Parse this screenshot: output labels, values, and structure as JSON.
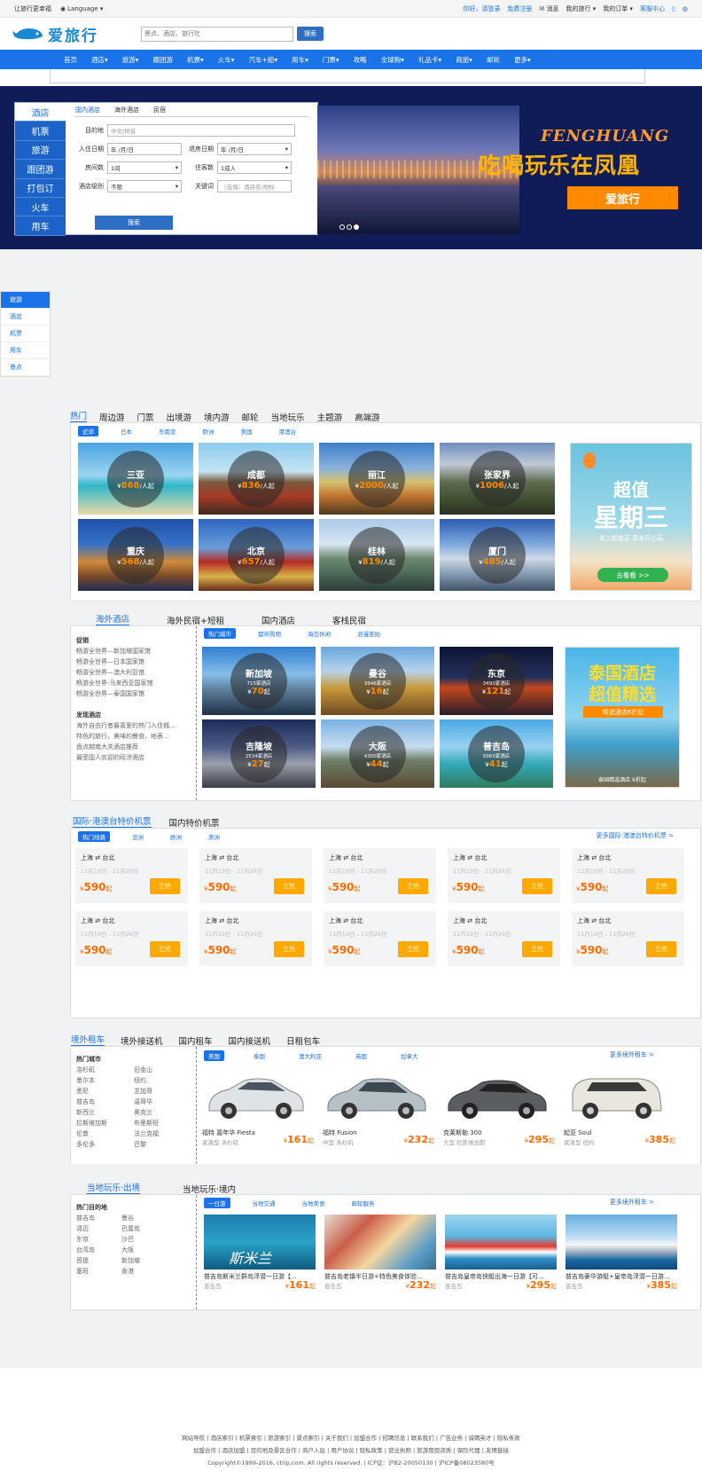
{
  "topbar": {
    "left": "让旅行更幸福",
    "language": "Language ▾",
    "right": [
      "你好，请登录",
      "免费注册",
      "消息",
      "我的旅行 ▾",
      "我的订单 ▾",
      "客服中心"
    ]
  },
  "header": {
    "logo_text": "爱旅行",
    "search_placeholder": "景点、酒店、旅行社",
    "search_button": "搜索"
  },
  "nav": [
    "首页",
    "酒店▾",
    "旅游▾",
    "跟团游",
    "机票▾",
    "火车▾",
    "汽车+船▾",
    "用车▾",
    "门票▾",
    "攻略",
    "全球购▾",
    "礼品卡▾",
    "商旅▾",
    "邮轮",
    "更多▾"
  ],
  "banner": {
    "side_tabs": [
      "酒店",
      "机票",
      "旅游",
      "跟团游",
      "打包订",
      "火车",
      "用车"
    ],
    "sub_tabs": [
      "国内酒店",
      "海外酒店",
      "民宿"
    ],
    "form": {
      "dest_label": "目的地",
      "dest_ph": "中文/拼音",
      "checkin_label": "入住日期",
      "checkin_ph": "年 /月/日",
      "checkout_label": "退房日期",
      "checkout_ph": "年 /月/日",
      "rooms_label": "房间数",
      "rooms_val": "1间",
      "guests_label": "住客数",
      "guests_val": "1成人",
      "level_label": "酒店级别",
      "level_val": "不限",
      "kw_label": "关键词",
      "kw_ph": "（选填）酒店名/地标",
      "submit": "搜索"
    },
    "title_en": "FENGHUANG",
    "slogan": "吃喝玩乐在凤凰",
    "brand_button": "爱旅行"
  },
  "side_nav": [
    "旅游",
    "酒店",
    "机票",
    "用车",
    "景点"
  ],
  "travel": {
    "tabs": [
      "热门",
      "周边游",
      "门票",
      "出境游",
      "境内游",
      "邮轮",
      "当地玩乐",
      "主题游",
      "高端游"
    ],
    "pills": [
      "近郊",
      "日本",
      "东南亚",
      "欧洲",
      "美国",
      "港澳台"
    ],
    "cards": [
      {
        "name": "三亚",
        "price": "868",
        "unit": "/人起"
      },
      {
        "name": "成都",
        "price": "836",
        "unit": "/人起"
      },
      {
        "name": "丽江",
        "price": "2000",
        "unit": "/人起"
      },
      {
        "name": "张家界",
        "price": "1006",
        "unit": "/人起"
      },
      {
        "name": "重庆",
        "price": "568",
        "unit": "/人起"
      },
      {
        "name": "北京",
        "price": "657",
        "unit": "/人起"
      },
      {
        "name": "桂林",
        "price": "819",
        "unit": "/人起"
      },
      {
        "name": "厦门",
        "price": "485",
        "unit": "/人起"
      }
    ],
    "promo": {
      "title": "超值",
      "title2": "星期三",
      "sub": "周三超值买 周末开心玩",
      "btn": "去看看 >>"
    }
  },
  "hotel": {
    "tabs": [
      "海外酒店",
      "海外民宿+短租",
      "国内酒店",
      "客栈民宿"
    ],
    "left_h1": "促销",
    "left_list1": [
      "畅游全世界—新加坡国家馆",
      "畅游全世界—日本国家馆",
      "畅游全世界—澳大利亚馆",
      "畅游全世界-马来西亚国家馆",
      "畅游全世界—泰国国家馆"
    ],
    "left_h2": "发现酒店",
    "left_list2": [
      "海外自由行者最喜爱的热门入住城...",
      "特色的旅行，美味的餐食，地表...",
      "盘点越南大关酒店推荐",
      "最受国人欢迎的经济酒店"
    ],
    "pills": [
      "热门城市",
      "都市购物",
      "海岛休闲",
      "浪漫旅拍"
    ],
    "cards": [
      {
        "name": "新加坡",
        "sub": "715家酒店",
        "price": "70",
        "unit": "起"
      },
      {
        "name": "曼谷",
        "sub": "3946家酒店",
        "price": "16",
        "unit": "起"
      },
      {
        "name": "东京",
        "sub": "3493家酒店",
        "price": "121",
        "unit": "起"
      },
      {
        "name": "吉隆坡",
        "sub": "2534家酒店",
        "price": "27",
        "unit": "起"
      },
      {
        "name": "大阪",
        "sub": "4300家酒店",
        "price": "44",
        "unit": "起"
      },
      {
        "name": "普吉岛",
        "sub": "5063家酒店",
        "price": "41",
        "unit": "起"
      }
    ],
    "promo": {
      "title": "泰国酒店",
      "title2": "超值精选",
      "tag": "精选酒店6折起",
      "caption": "泰国精选酒店 6折起"
    }
  },
  "flights": {
    "tabs": [
      "国际·港澳台特价机票",
      "国内特价机票"
    ],
    "pills": [
      "热门线路",
      "亚洲",
      "欧洲",
      "美洲"
    ],
    "more": "更多国际·港澳台特价机票 >",
    "items": [
      {
        "from": "上海",
        "to": "台北",
        "dates": "11月19日 - 11月26日",
        "price": "590",
        "btn": "立抢"
      },
      {
        "from": "上海",
        "to": "台北",
        "dates": "11月19日 - 11月26日",
        "price": "590",
        "btn": "立抢"
      },
      {
        "from": "上海",
        "to": "台北",
        "dates": "11月19日 - 11月26日",
        "price": "590",
        "btn": "立抢"
      },
      {
        "from": "上海",
        "to": "台北",
        "dates": "11月19日 - 11月26日",
        "price": "590",
        "btn": "立抢"
      },
      {
        "from": "上海",
        "to": "台北",
        "dates": "11月19日 - 11月26日",
        "price": "590",
        "btn": "立抢"
      },
      {
        "from": "上海",
        "to": "台北",
        "dates": "11月19日 - 11月26日",
        "price": "590",
        "btn": "立抢"
      },
      {
        "from": "上海",
        "to": "台北",
        "dates": "11月19日 - 11月26日",
        "price": "590",
        "btn": "立抢"
      },
      {
        "from": "上海",
        "to": "台北",
        "dates": "11月19日 - 11月26日",
        "price": "590",
        "btn": "立抢"
      },
      {
        "from": "上海",
        "to": "台北",
        "dates": "11月19日 - 11月26日",
        "price": "590",
        "btn": "立抢"
      },
      {
        "from": "上海",
        "to": "台北",
        "dates": "11月19日 - 11月26日",
        "price": "590",
        "btn": "立抢"
      }
    ],
    "price_unit": "起"
  },
  "cars": {
    "tabs": [
      "境外租车",
      "境外接送机",
      "国内租车",
      "国内接送机",
      "日租包车"
    ],
    "left_h": "热门城市",
    "left_col1": [
      "洛杉矶",
      "墨尔本",
      "悉尼",
      "普吉岛",
      "新西兰",
      "拉斯维加斯",
      "伦敦",
      "多伦多"
    ],
    "left_col2": [
      "旧金山",
      "纽约",
      "芝加哥",
      "温哥华",
      "奥克兰",
      "布里斯班",
      "法兰克福",
      "巴黎"
    ],
    "pills": [
      "美国",
      "泰国",
      "澳大利亚",
      "英国",
      "加拿大"
    ],
    "more": "更多境外租车 >",
    "items": [
      {
        "name": "福特 嘉年华 Fiesta",
        "sub": "紧凑型 洛杉矶",
        "price": "161",
        "color": "#dfe3e7"
      },
      {
        "name": "福特 Fusion",
        "sub": "中型 洛杉矶",
        "price": "232",
        "color": "#b6c0c7"
      },
      {
        "name": "克莱斯勒 300",
        "sub": "大型 拉斯维加斯",
        "price": "295",
        "color": "#5a5d62"
      },
      {
        "name": "起亚 Soul",
        "sub": "紧凑型 纽约",
        "price": "385",
        "color": "#e8e6dd"
      }
    ],
    "price_unit": "起"
  },
  "play": {
    "tabs": [
      "当地玩乐·出境",
      "当地玩乐·境内"
    ],
    "left_h": "热门目的地",
    "left_col1": [
      "普吉岛",
      "清迈",
      "东京",
      "台湾岛",
      "芭提",
      "塞班"
    ],
    "left_col2": [
      "曼谷",
      "巴厘岛",
      "沙巴",
      "大阪",
      "新加坡",
      "香港"
    ],
    "pills": [
      "一日游",
      "当地交通",
      "当地美食",
      "邮轮服务"
    ],
    "more": "更多境外租车 >",
    "items": [
      {
        "name": "普吉岛斯米兰群岛浮潜一日游【...",
        "sub": "普吉岛",
        "price": "161",
        "overlay": "斯米兰"
      },
      {
        "name": "普吉岛老镇半日游+特色美食体验...",
        "sub": "普吉岛",
        "price": "232",
        "overlay": ""
      },
      {
        "name": "普吉岛皇帝岛快艇出海一日游【可...",
        "sub": "普吉岛",
        "price": "295",
        "overlay": ""
      },
      {
        "name": "普吉岛豪华游艇+皇帝岛浮潜一日游...",
        "sub": "普吉岛",
        "price": "385",
        "overlay": ""
      }
    ],
    "price_unit": "起"
  },
  "footer": {
    "line1": "网站导航 | 酒店索引 | 机票索引 | 旅游索引 | 景点索引 | 关于我们 | 加盟合作 | 招聘信息 | 联系我们 | 广告业务 | 诚聘英才 | 隐私条款",
    "line2": "加盟合作 | 酒店加盟 | 目的地及景区合作 | 商户入驻 | 用户协议 | 隐私政策 | 营业执照 | 旅游度假资质 | 保险代理 | 友情链接",
    "line3": "Copyright©1999-2016, ctrip.com. All rights reserved. | ICP证：沪B2-20050130 | 沪ICP备08023580号"
  }
}
